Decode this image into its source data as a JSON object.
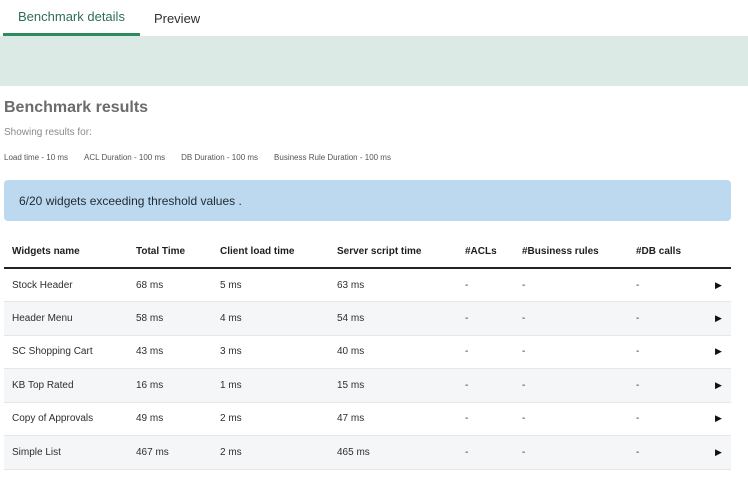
{
  "tabs": [
    {
      "label": "Benchmark details",
      "active": true
    },
    {
      "label": "Preview",
      "active": false
    }
  ],
  "results": {
    "title": "Benchmark results",
    "subtitle": "Showing results for:",
    "filters": [
      "Load time - 10 ms",
      "ACL Duration - 100 ms",
      "DB Duration - 100 ms",
      "Business Rule Duration - 100 ms"
    ],
    "alert": "6/20 widgets exceeding threshold values ."
  },
  "table": {
    "headers": [
      "Widgets name",
      "Total Time",
      "Client load time",
      "Server script time",
      "#ACLs",
      "#Business rules",
      "#DB calls"
    ],
    "rows": [
      {
        "name": "Stock Header",
        "total": "68 ms",
        "client": "5 ms",
        "server": "63 ms",
        "acls": "-",
        "br": "-",
        "db": "-",
        "expand": "▶"
      },
      {
        "name": "Header Menu",
        "total": "58 ms",
        "client": "4 ms",
        "server": "54 ms",
        "acls": "-",
        "br": "-",
        "db": "-",
        "expand": "▶"
      },
      {
        "name": "SC Shopping Cart",
        "total": "43 ms",
        "client": "3 ms",
        "server": "40 ms",
        "acls": "-",
        "br": "-",
        "db": "-",
        "expand": "▶"
      },
      {
        "name": "KB Top Rated",
        "total": "16 ms",
        "client": "1 ms",
        "server": "15 ms",
        "acls": "-",
        "br": "-",
        "db": "-",
        "expand": "▶"
      },
      {
        "name": "Copy of Approvals",
        "total": "49 ms",
        "client": "2 ms",
        "server": "47 ms",
        "acls": "-",
        "br": "-",
        "db": "-",
        "expand": "▶"
      },
      {
        "name": "Simple List",
        "total": "467 ms",
        "client": "2 ms",
        "server": "465 ms",
        "acls": "-",
        "br": "-",
        "db": "-",
        "expand": "▶"
      }
    ]
  },
  "colors": {
    "accent": "#2f8a5e",
    "banner": "#dbeae5",
    "alert_bg": "#bcd9f0"
  },
  "icons": {
    "expand": "play-arrow-icon"
  }
}
